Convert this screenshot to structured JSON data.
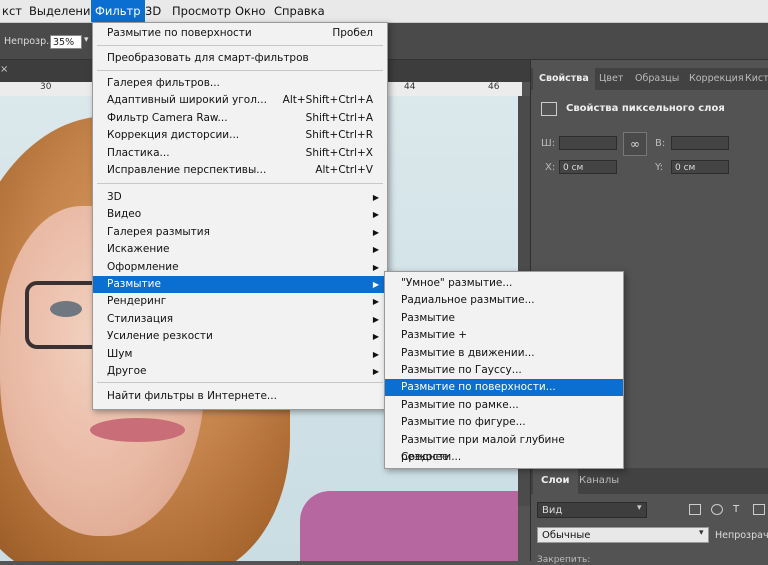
{
  "menubar": {
    "items": [
      "кст",
      "Выделение",
      "Фильтр",
      "3D",
      "Просмотр",
      "Окно",
      "Справка"
    ]
  },
  "options": {
    "label": "Непрозр.:",
    "value": "35%",
    "arrow": "▾"
  },
  "tabs": {
    "close": "×"
  },
  "ruler": {
    "marks": [
      "30",
      "44",
      "46"
    ]
  },
  "filter_menu": {
    "group1": [
      {
        "label": "Размытие по поверхности",
        "shortcut": "Пробел"
      }
    ],
    "group2": [
      {
        "label": "Преобразовать для смарт-фильтров"
      }
    ],
    "group3": [
      {
        "label": "Галерея фильтров..."
      },
      {
        "label": "Адаптивный широкий угол...",
        "shortcut": "Alt+Shift+Ctrl+A"
      },
      {
        "label": "Фильтр Camera Raw...",
        "shortcut": "Shift+Ctrl+A"
      },
      {
        "label": "Коррекция дисторсии...",
        "shortcut": "Shift+Ctrl+R"
      },
      {
        "label": "Пластика...",
        "shortcut": "Shift+Ctrl+X"
      },
      {
        "label": "Исправление перспективы...",
        "shortcut": "Alt+Ctrl+V"
      }
    ],
    "group4": [
      {
        "label": "3D"
      },
      {
        "label": "Видео"
      },
      {
        "label": "Галерея размытия"
      },
      {
        "label": "Искажение"
      },
      {
        "label": "Оформление"
      },
      {
        "label": "Размытие"
      },
      {
        "label": "Рендеринг"
      },
      {
        "label": "Стилизация"
      },
      {
        "label": "Усиление резкости"
      },
      {
        "label": "Шум"
      },
      {
        "label": "Другое"
      }
    ],
    "group5": [
      {
        "label": "Найти фильтры в Интернете..."
      }
    ],
    "highlighted": "Размытие"
  },
  "blur_submenu": {
    "items": [
      "\"Умное\" размытие...",
      "Радиальное размытие...",
      "Размытие",
      "Размытие +",
      "Размытие в движении...",
      "Размытие по Гауссу...",
      "Размытие по поверхности...",
      "Размытие по рамке...",
      "Размытие по фигуре...",
      "Размытие при малой глубине резкости...",
      "Среднее"
    ],
    "highlighted": "Размытие по поверхности..."
  },
  "panel": {
    "tabs": [
      "Свойства",
      "Цвет",
      "Образцы",
      "Коррекция",
      "Кисти"
    ],
    "title": "Свойства пиксельного слоя",
    "w_label": "Ш:",
    "h_label": "В:",
    "x_label": "X:",
    "x_value": "0 см",
    "y_label": "Y:",
    "y_value": "0 см",
    "link_icon": "∞"
  },
  "layers": {
    "tabs": [
      "Слои",
      "Каналы"
    ],
    "kind": "Вид",
    "blend": "Обычные",
    "opacity_label": "Непрозрачн",
    "lock_label": "Закрепить:"
  },
  "colors": {
    "accent": "#0a6fd1",
    "menu_bg": "#f2f2f2",
    "panel_bg": "#535353"
  }
}
